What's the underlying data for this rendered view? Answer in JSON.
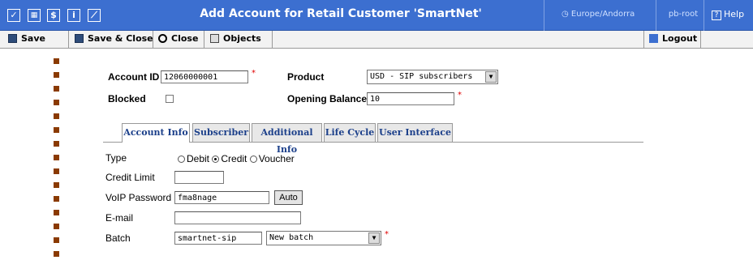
{
  "titlebar": {
    "title": "Add Account for Retail Customer 'SmartNet'",
    "timezone": "Europe/Andorra",
    "user": "pb-root",
    "help": "Help",
    "icons": [
      "checkbox-icon",
      "grid-icon",
      "dollar-icon",
      "info-icon",
      "chart-icon"
    ]
  },
  "toolbar": {
    "save": "Save",
    "save_close": "Save & Close",
    "close": "Close",
    "objects": "Objects",
    "logout": "Logout"
  },
  "form": {
    "account_id_label": "Account ID",
    "account_id_value": "12060000001",
    "product_label": "Product",
    "product_value": "USD - SIP subscribers",
    "blocked_label": "Blocked",
    "opening_balance_label": "Opening Balance",
    "opening_balance_value": "10",
    "required_mark": "*"
  },
  "tabs": [
    "Account Info",
    "Subscriber",
    "Additional Info",
    "Life Cycle",
    "User Interface"
  ],
  "account_info": {
    "type_label": "Type",
    "type_options": [
      "Debit",
      "Credit",
      "Voucher"
    ],
    "type_selected": "Credit",
    "credit_limit_label": "Credit Limit",
    "credit_limit_value": "",
    "voip_password_label": "VoIP Password",
    "voip_password_value": "fma8nage",
    "auto_button": "Auto",
    "email_label": "E-mail",
    "email_value": "",
    "batch_label": "Batch",
    "batch_value": "smartnet-sip",
    "batch_select": "New batch"
  },
  "colors": {
    "titlebar": "#3c6fd0",
    "tab_text": "#1b3f8a",
    "bullet": "#8a3a00",
    "required": "#e00000"
  }
}
